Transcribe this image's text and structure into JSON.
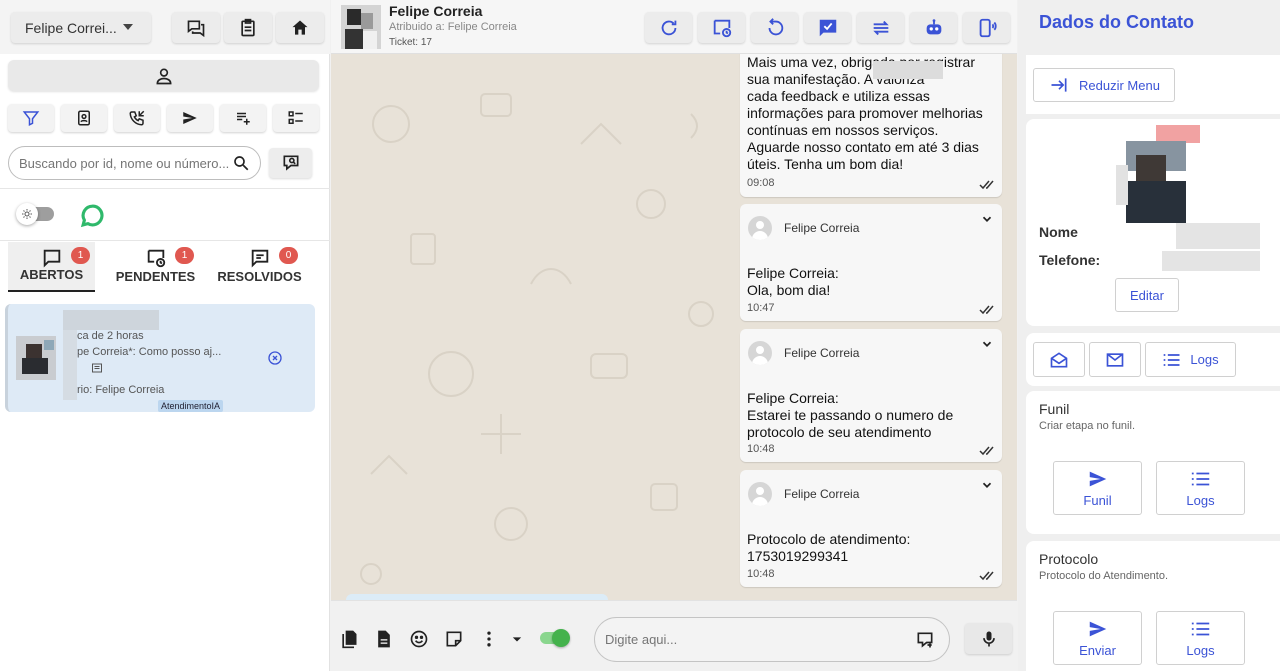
{
  "left": {
    "user_select_label": "Felipe Correi...",
    "search": {
      "placeholder": "Buscando por id, nome ou número..."
    },
    "tabs": [
      {
        "label": "ABERTOS",
        "count": "1"
      },
      {
        "label": "PENDENTES",
        "count": "1"
      },
      {
        "label": "RESOLVIDOS",
        "count": "0"
      }
    ],
    "ticket": {
      "time": "ca de 2 horas",
      "preview": "pe Correia*: Como posso aj...",
      "user": "rio: Felipe Correia",
      "tag": "AtendimentoIA"
    }
  },
  "chat": {
    "header": {
      "name": "Felipe Correia",
      "assigned": "Atribuido a: Felipe Correia",
      "ticket": "Ticket: 17"
    },
    "messages": [
      {
        "text": "Mais uma vez, obrigada por registrar\nsua manifestação. A          valoriza\ncada feedback e utiliza essas\ninformações para promover melhorias\ncontínuas em nossos serviços.\nAguarde nosso contato em até 3 dias\núteis. Tenha um bom dia!",
        "time": "09:08"
      },
      {
        "sender": "Felipe Correia",
        "text": "Felipe Correia:\nOla, bom dia!",
        "time": "10:47"
      },
      {
        "sender": "Felipe Correia",
        "text": "Felipe Correia:\nEstarei te passando o numero de\nprotocolo de seu atendimento",
        "time": "10:48"
      },
      {
        "sender": "Felipe Correia",
        "text": "Protocolo de atendimento:\n1753019299341",
        "time": "10:48"
      }
    ],
    "composer": {
      "placeholder": "Digite aqui..."
    }
  },
  "right": {
    "title": "Dados do Contato",
    "reduce_label": "Reduzir Menu",
    "name_label": "Nome",
    "phone_label": "Telefone:",
    "edit_label": "Editar",
    "logs_label": "Logs",
    "funil": {
      "title": "Funil",
      "subtitle": "Criar etapa no funil.",
      "btn1": "Funil",
      "btn2": "Logs"
    },
    "protocolo": {
      "title": "Protocolo",
      "subtitle": "Protocolo do Atendimento.",
      "btn1": "Enviar",
      "btn2": "Logs"
    }
  },
  "colors": {
    "accent": "#3b53d6",
    "badge": "#e05850",
    "whatsapp": "#2fb96b",
    "toggle_on": "#44b24c"
  }
}
